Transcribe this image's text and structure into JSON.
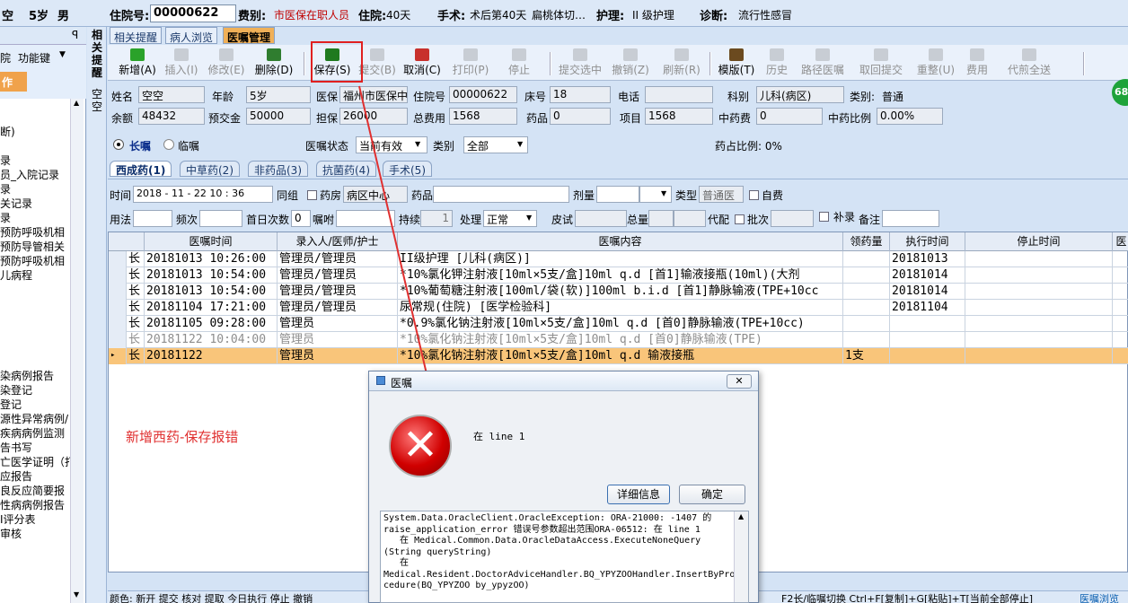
{
  "patient_bar": {
    "name_partial": "空",
    "age": "5岁",
    "sex": "男",
    "admission_no_label": "住院号:",
    "admission_no": "00000622",
    "fee_type_label": "费别:",
    "fee_type": "市医保在职人员",
    "stay_label": "住院:",
    "stay": "40天",
    "surgery_label": "手术:",
    "surgery": "术后第40天",
    "surgery_name": "扁桃体切…",
    "nursing_label": "护理:",
    "nursing": "II 级护理",
    "diagnosis_label": "诊断:",
    "diagnosis": "流行性感冒"
  },
  "left_sidebar": {
    "pin": "ꟼ",
    "tool1": "院",
    "tool2": "功能键",
    "caption": "作",
    "items": [
      "断)",
      "录",
      "员_入院记录",
      "录",
      "关记录",
      "录",
      "预防呼吸机相",
      "预防导管相关",
      "预防呼吸机相",
      "儿病程",
      "染病例报告",
      "染登记",
      "登记",
      "源性异常病例/",
      "疾病病例监测",
      "告书写",
      "亡医学证明（打",
      "应报告",
      "良反应简要报",
      "性病病例报告",
      "I评分表",
      "审核"
    ]
  },
  "vertical_tabs": [
    "相关提醒",
    "空空"
  ],
  "tabs": [
    "相关提醒",
    "病人浏览",
    "医嘱管理"
  ],
  "toolbar": [
    {
      "label": "新增(A)",
      "icon": "plus-icon",
      "color": "#2aa22a",
      "disabled": false
    },
    {
      "label": "插入(I)",
      "icon": "insert-icon",
      "color": "#c8cdd4",
      "disabled": true
    },
    {
      "label": "修改(E)",
      "icon": "edit-icon",
      "color": "#c8cdd4",
      "disabled": true
    },
    {
      "label": "删除(D)",
      "icon": "minus-icon",
      "color": "#2f7d2f",
      "disabled": false
    },
    {
      "label": "保存(S)",
      "icon": "floppy-icon",
      "color": "#1f7a1f",
      "disabled": false
    },
    {
      "label": "提交(B)",
      "icon": "submit-icon",
      "color": "#c8cdd4",
      "disabled": true
    },
    {
      "label": "取消(C)",
      "icon": "undo-icon",
      "color": "#c8302c",
      "disabled": false
    },
    {
      "label": "打印(P)",
      "icon": "printer-icon",
      "color": "#c8cdd4",
      "disabled": true
    },
    {
      "label": "停止",
      "icon": "stop-icon",
      "color": "#c8cdd4",
      "disabled": true
    },
    {
      "label": "提交选中",
      "icon": "submit-selected-icon",
      "color": "#c8cdd4",
      "disabled": true
    },
    {
      "label": "撤销(Z)",
      "icon": "trash-icon",
      "color": "#c8cdd4",
      "disabled": true
    },
    {
      "label": "刷新(R)",
      "icon": "refresh-icon",
      "color": "#c8cdd4",
      "disabled": true
    },
    {
      "label": "模版(T)",
      "icon": "book-icon",
      "color": "#6b4a1f",
      "disabled": false
    },
    {
      "label": "历史",
      "icon": "history-icon",
      "color": "#c8cdd4",
      "disabled": true
    },
    {
      "label": "路径医嘱",
      "icon": "path-icon",
      "color": "#c8cdd4",
      "disabled": true
    },
    {
      "label": "取回提交",
      "icon": "retrieve-icon",
      "color": "#c8cdd4",
      "disabled": true
    },
    {
      "label": "重整(U)",
      "icon": "reorganize-icon",
      "color": "#c8cdd4",
      "disabled": true
    },
    {
      "label": "费用",
      "icon": "fee-icon",
      "color": "#c8cdd4",
      "disabled": true
    },
    {
      "label": "代煎全送",
      "icon": "decoct-icon",
      "color": "#c8cdd4",
      "disabled": true
    }
  ],
  "info": {
    "name_label": "姓名",
    "name": "空空",
    "age_label": "年龄",
    "age": "5岁",
    "insurance_label": "医保",
    "insurance": "福州市医保中",
    "admission_label": "住院号",
    "admission": "00000622",
    "bed_label": "床号",
    "bed": "18",
    "phone_label": "电话",
    "phone": "",
    "dept_label": "科别",
    "dept": "儿科(病区)",
    "category_label": "类别:",
    "category": "普通",
    "balance_label": "余额",
    "balance": "48432",
    "deposit_label": "预交金",
    "deposit": "50000",
    "guarantee_label": "担保",
    "guarantee": "26000",
    "total_fee_label": "总费用",
    "total_fee": "1568",
    "drug_label": "药品",
    "drug": "0",
    "item_label": "项目",
    "item": "1568",
    "tcm_label": "中药费",
    "tcm": "0",
    "tcm_ratio_label": "中药比例",
    "tcm_ratio": "0.00%"
  },
  "order_filter": {
    "long_label": "长嘱",
    "temp_label": "临嘱",
    "status_label": "医嘱状态",
    "status": "当前有效",
    "type_label": "类别",
    "type": "全部",
    "drug_ratio": "药占比例: 0%"
  },
  "advice_tabs": [
    "西成药(1)",
    "中草药(2)",
    "非药品(3)",
    "抗菌药(4)",
    "手术(5)"
  ],
  "form": {
    "time_label": "时间",
    "time": "2018 - 11 - 22   10 : 36",
    "group_label": "同组",
    "pharmacy_label": "药房",
    "pharmacy": "病区中心",
    "drug_label": "药品",
    "drug": "",
    "dose_label": "剂量",
    "dose": "",
    "kind_label": "类型",
    "kind": "普通医",
    "self_pay_label": "自费",
    "usage_label": "用法",
    "usage": "",
    "freq_label": "频次",
    "freq": "",
    "first_day_label": "首日次数",
    "first_day": "0",
    "entrust_label": "嘱咐",
    "entrust": "",
    "duration_label": "持续",
    "duration": "1",
    "handle_label": "处理",
    "handle": "正常",
    "skin_label": "皮试",
    "skin": "",
    "total_label": "总量",
    "total": "",
    "decoct_label": "代配",
    "batch_label": "批次",
    "batch": "",
    "supplement_label": "补录",
    "note_label": "备注",
    "note": ""
  },
  "grid": {
    "headers": [
      "医嘱时间",
      "录入人/医师/护士",
      "医嘱内容",
      "领药量",
      "执行时间",
      "停止时间",
      "医"
    ],
    "rows": [
      {
        "flag": "长",
        "time": "20181013 10:26:00",
        "person": "管理员/管理员",
        "content": "II级护理   [儿科(病区)]",
        "qty": "",
        "exec": "20181013",
        "stop": "",
        "state": "normal"
      },
      {
        "flag": "长",
        "time": "20181013 10:54:00",
        "person": "管理员/管理员",
        "content": "*10%氯化钾注射液[10ml×5支/盒]10ml q.d  [首1]输液接瓶(10ml)(大剂",
        "qty": "",
        "exec": "20181014",
        "stop": "",
        "state": "normal"
      },
      {
        "flag": "长",
        "time": "20181013 10:54:00",
        "person": "管理员/管理员",
        "content": "*10%葡萄糖注射液[100ml/袋(软)]100ml b.i.d  [首1]静脉输液(TPE+10cc",
        "qty": "",
        "exec": "20181014",
        "stop": "",
        "state": "normal"
      },
      {
        "flag": "长",
        "time": "20181104 17:21:00",
        "person": "管理员/管理员",
        "content": "尿常规(住院)   [医学检验科]",
        "qty": "",
        "exec": "20181104",
        "stop": "",
        "state": "normal"
      },
      {
        "flag": "长",
        "time": "20181105 09:28:00",
        "person": "管理员",
        "content": "*0.9%氯化钠注射液[10ml×5支/盒]10ml q.d  [首0]静脉输液(TPE+10cc)",
        "qty": "",
        "exec": "",
        "stop": "",
        "state": "normal"
      },
      {
        "flag": "长",
        "time": "20181122 10:04:00",
        "person": "管理员",
        "content": "*10%氯化钠注射液[10ml×5支/盒]10ml q.d  [首0]静脉输液(TPE)",
        "qty": "",
        "exec": "",
        "stop": "",
        "state": "dim"
      },
      {
        "flag": "长",
        "time": "20181122",
        "person": "管理员",
        "content": "*10%氯化钠注射液[10ml×5支/盒]10ml q.d  输液接瓶",
        "qty": "1支",
        "exec": "",
        "stop": "",
        "state": "sel"
      }
    ]
  },
  "annotation": "新增西药-保存报错",
  "status_bar": {
    "left": "颜色: 新开  提交  核对  提取  今日执行  停止  撤销",
    "right": "F2长/临嘱切换 Ctrl+F[复制]+G[粘贴]+T[当前全部停止]",
    "far_right": "医嘱浏览"
  },
  "badge": "68",
  "dialog": {
    "title": "医嘱",
    "message": "在 line 1",
    "detail_button": "详细信息",
    "ok_button": "确定",
    "detail": "System.Data.OracleClient.OracleException: ORA-21000: -1407 的\nraise_application_error 错误号参数超出范围ORA-06512: 在 line 1\n   在 Medical.Common.Data.OracleDataAccess.ExecuteNoneQuery\n(String queryString)\n   在\nMedical.Resident.DoctorAdviceHandler.BQ_YPYZOOHandler.InsertByPro\ncedure(BQ_YPYZOO by_ypyzOO)"
  },
  "colors": {
    "accent": "#f0a24b",
    "error_red": "#d00000",
    "annotation_red": "#e03030",
    "selected_row": "#f9c57a"
  }
}
